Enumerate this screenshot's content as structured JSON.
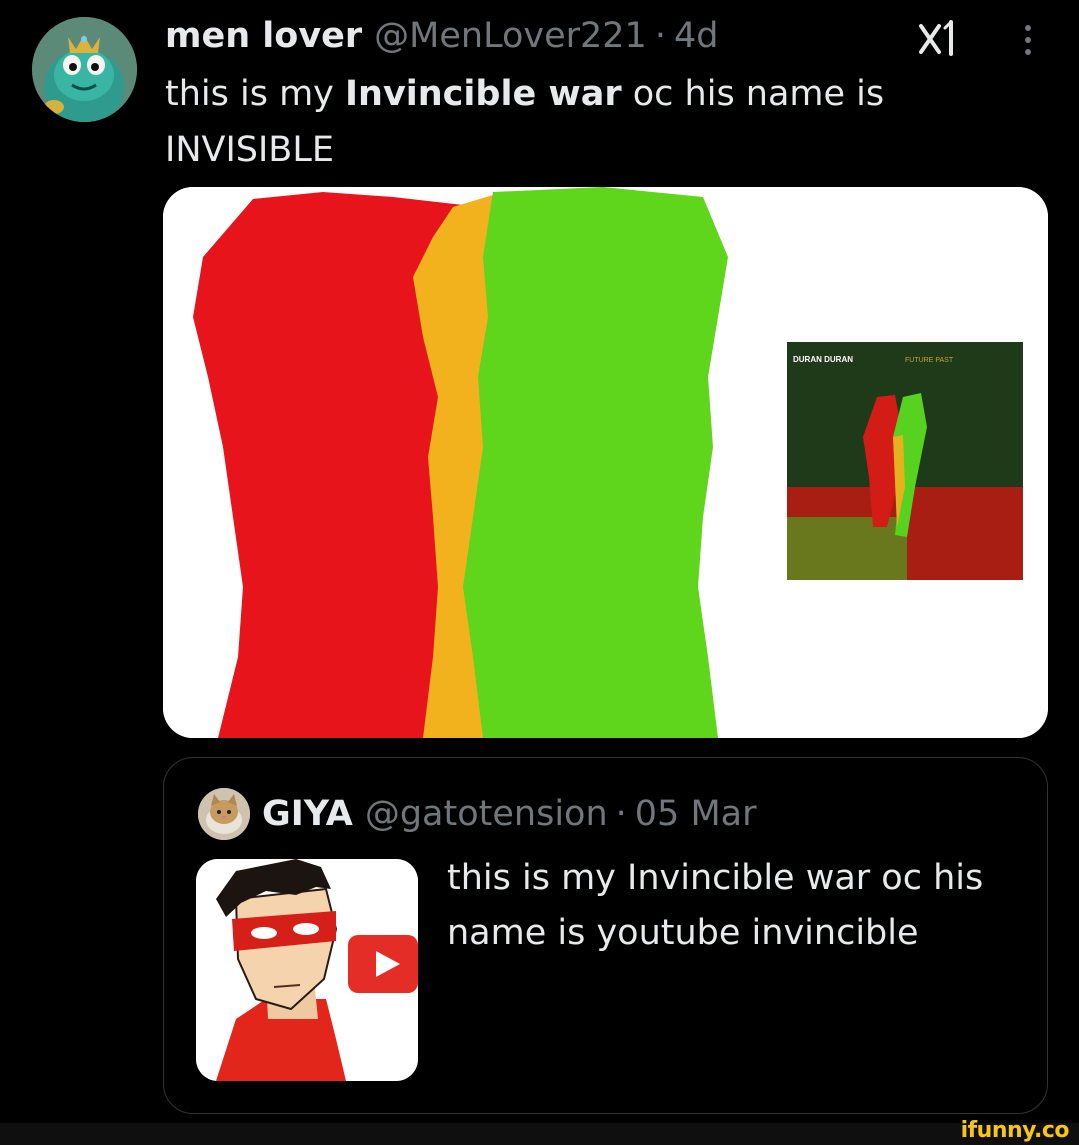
{
  "tweet": {
    "display_name": "men lover",
    "handle": "@MenLover221",
    "separator": "·",
    "time": "4d",
    "text_prefix": "this is my ",
    "text_bold": "Invincible war",
    "text_suffix": " oc his name is INVISIBLE",
    "avatar_icon": "frog-character-avatar",
    "grok_icon": "grok-icon",
    "more_icon": "more-vertical-icon",
    "media": {
      "album_title": "DURAN DURAN",
      "album_subtitle": "FUTURE PAST",
      "colors": {
        "red": "#e8141c",
        "yellow": "#f2b21e",
        "green": "#5fd51b",
        "white": "#ffffff"
      }
    }
  },
  "quoted_tweet": {
    "display_name": "GIYA",
    "handle": "@gatotension",
    "separator": "·",
    "time": "05 Mar",
    "text": "this is my Invincible war oc his name is youtube invincible",
    "avatar_icon": "cat-avatar",
    "thumbnail_icon": "youtube-invincible-drawing"
  },
  "watermark": "ifunny.co",
  "colors": {
    "background": "#000000",
    "text": "#e7e9ea",
    "muted": "#71767b",
    "border": "#2f3336"
  }
}
